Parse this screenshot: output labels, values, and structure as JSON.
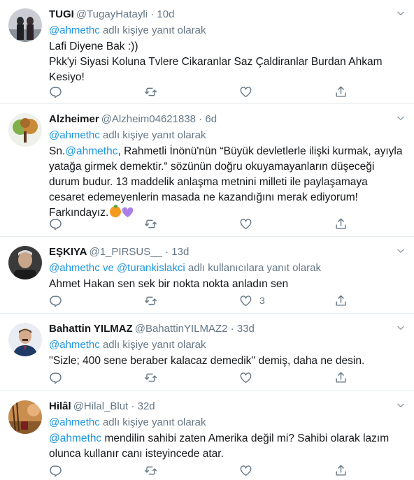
{
  "reply_prefix": "adlı kişiye yanıt olarak",
  "reply_prefix_multi": "adlı kullanıcılara yanıt olarak",
  "reply_and": "ve",
  "tweets": [
    {
      "name": "TUGI",
      "handle": "@TugayHatayli",
      "time": "· 10d",
      "reply_to": "@ahmethc",
      "lines": [
        "Lafi Diyene Bak :))",
        "Pkk'yi Siyasi Koluna Tvlere Cikaranlar Saz Çaldiranlar  Burdan Ahkam Kesiyo!"
      ],
      "likes": ""
    },
    {
      "name": "Alzheimer",
      "handle": "@Alzheim04621838",
      "time": "· 6d",
      "reply_to": "@ahmethc",
      "body_prefix": "Sn.",
      "body_mention": "@ahmethc",
      "body_rest": ",  Rahmetli İnönü'nün “Büyük devletlerle ilişki kurmak, ayıyla yatağa girmek demektir.“ sözünün doğru okuyamayanların düşeceği durum budur. 13 maddelik anlaşma metnini milleti ile paylaşamaya cesaret edemeyenlerin masada ne kazandığını merak ediyorum!",
      "last_line": "Farkındayız.",
      "likes": ""
    },
    {
      "name": "EŞKIYA",
      "handle": "@1_PIRSUS__",
      "time": "· 13d",
      "reply_to": "@ahmethc",
      "reply_to_2": "@turankislakci",
      "lines": [
        "Ahmet Hakan sen sek bir nokta nokta anladın sen"
      ],
      "likes": "3"
    },
    {
      "name": "Bahattin YILMAZ",
      "handle": "@BahattinYILMAZ2",
      "time": "· 33d",
      "reply_to": "@ahmethc",
      "lines": [
        "''Sizle; 400 sene beraber kalacaz demedik'' demiş, daha ne desin."
      ],
      "likes": ""
    },
    {
      "name": "Hilâl",
      "handle": "@Hilal_Blut",
      "time": "· 32d",
      "reply_to": "@ahmethc",
      "body_mention": "@ahmethc",
      "body_rest": " mendilin sahibi zaten Amerika değil mi? Sahibi olarak lazım olunca kullanır canı isteyincede atar.",
      "likes": ""
    }
  ],
  "icons": {
    "reply": "reply-icon",
    "retweet": "retweet-icon",
    "like": "heart-icon",
    "share": "share-icon",
    "more": "chevron-down-icon"
  },
  "colors": {
    "text": "#14171a",
    "secondary": "#657786",
    "link": "#1b95e0",
    "divider": "#e6ecf0"
  }
}
